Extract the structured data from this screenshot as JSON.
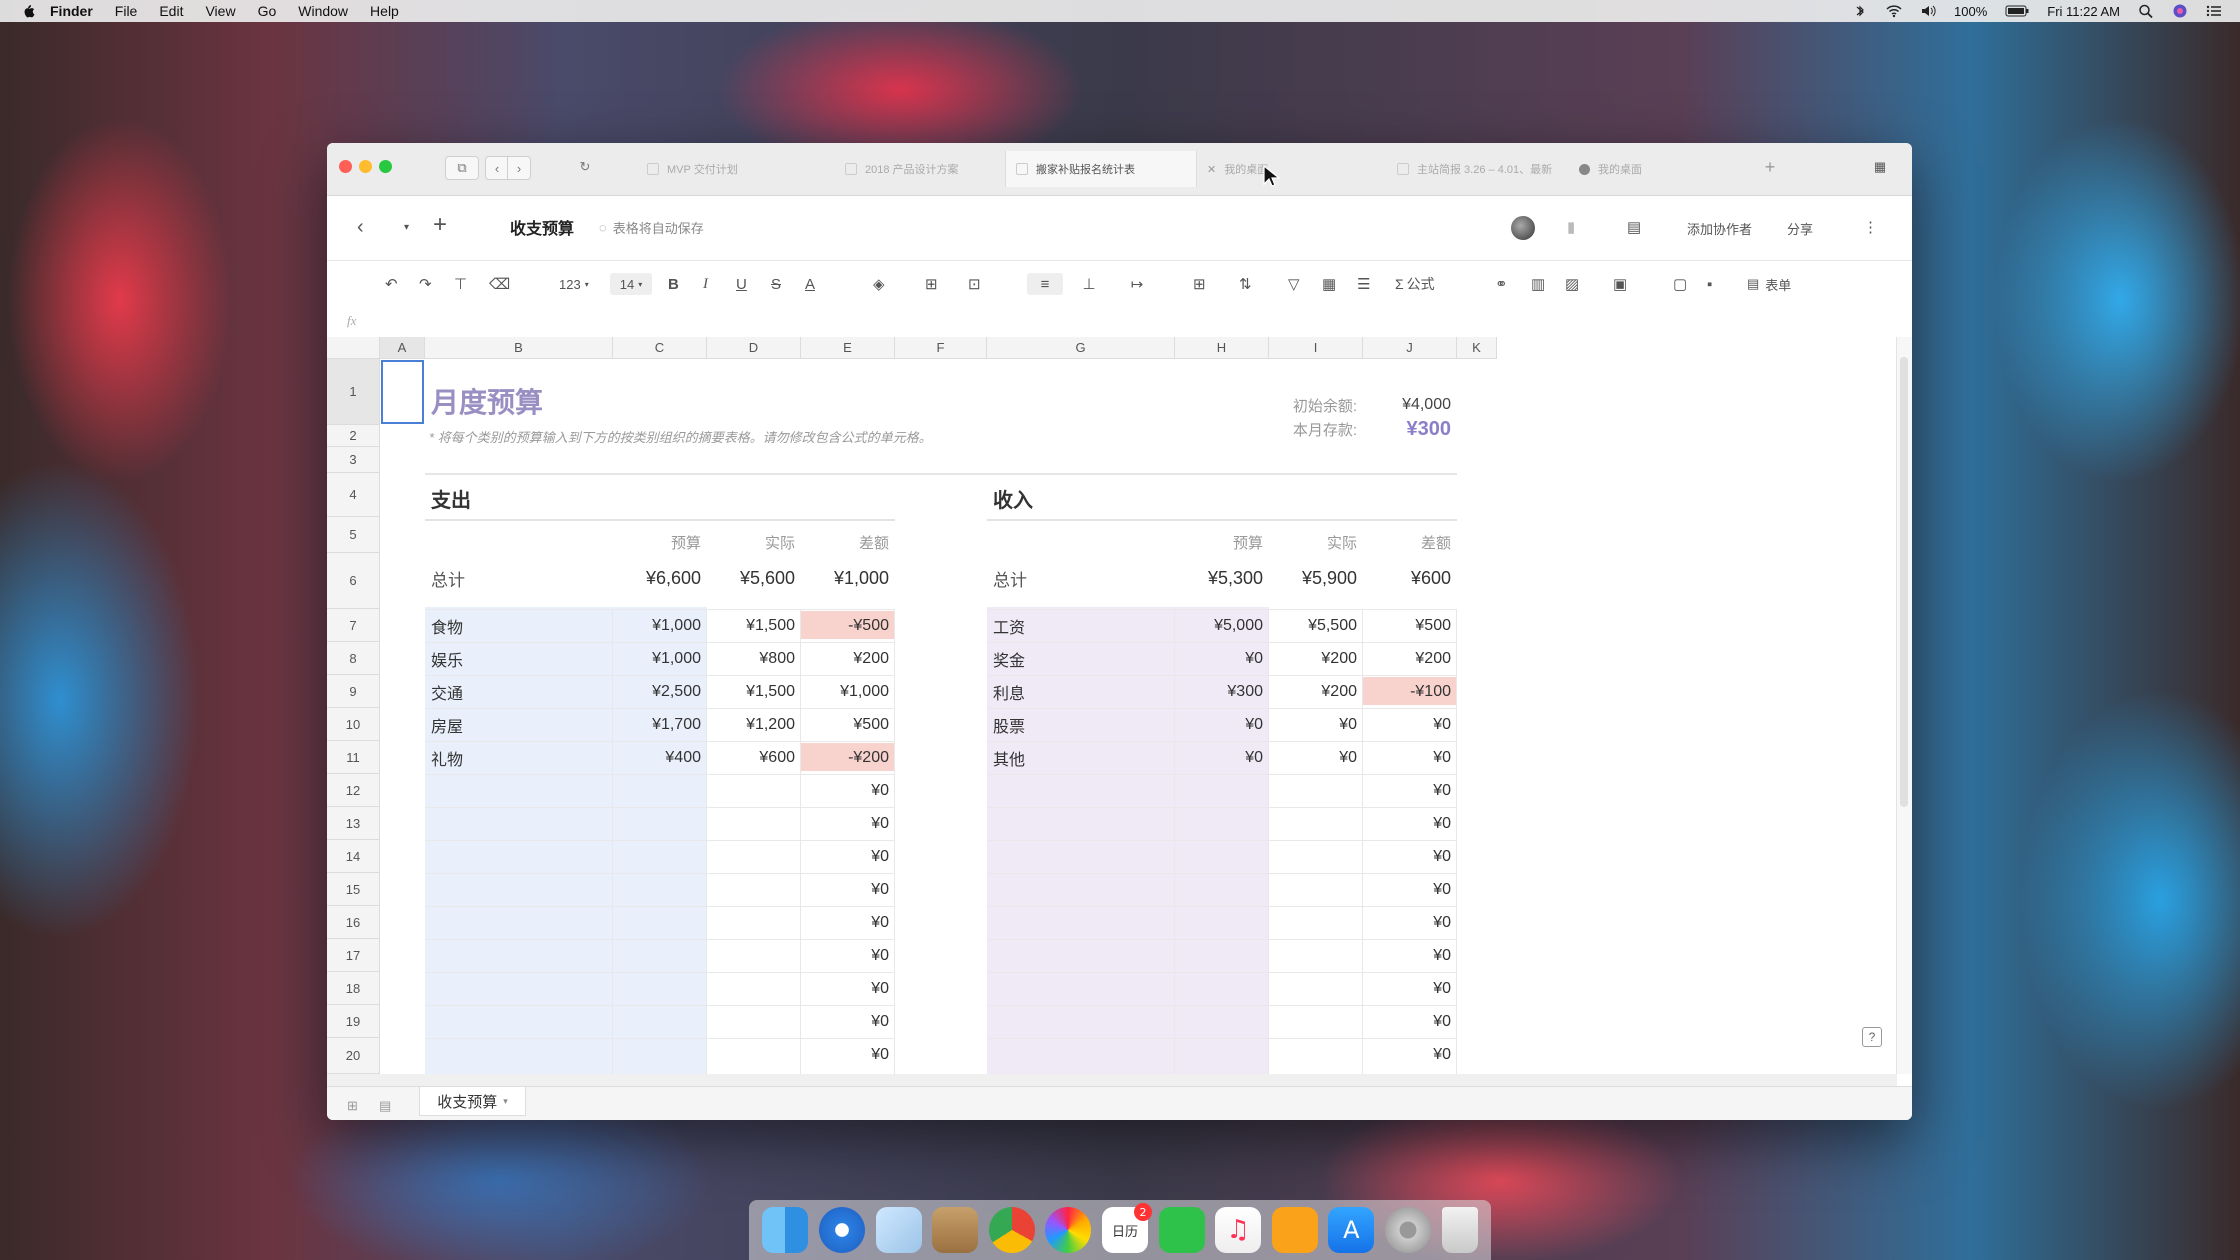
{
  "menubar": {
    "app": "Finder",
    "items": [
      "File",
      "Edit",
      "View",
      "Go",
      "Window",
      "Help"
    ],
    "battery": "100%",
    "clock": "Fri 11:22 AM"
  },
  "tabs": [
    {
      "label": "MVP 交付计划"
    },
    {
      "label": "2018 产品设计方案"
    },
    {
      "label": "搬家补贴报名统计表"
    },
    {
      "label": "我的桌面"
    },
    {
      "label": "主站简报 3.26 – 4.01、最新"
    },
    {
      "label": "我的桌面"
    }
  ],
  "header": {
    "title": "收支预算",
    "autosave": "表格将自动保存",
    "collab_btn": "添加协作者",
    "share_btn": "分享"
  },
  "toolbar": {
    "number_format": "123",
    "font_size": "14",
    "formula_label": "公式",
    "form_label": "表单"
  },
  "fx_label": "fx",
  "columns": [
    "A",
    "B",
    "C",
    "D",
    "E",
    "F",
    "G",
    "H",
    "I",
    "J",
    "K"
  ],
  "rows": [
    "1",
    "2",
    "3",
    "4",
    "5",
    "6",
    "7",
    "8",
    "9",
    "10",
    "11",
    "12",
    "13",
    "14",
    "15",
    "16",
    "17",
    "18",
    "19",
    "20"
  ],
  "sheet": {
    "title": "月度预算",
    "subtitle": "* 将每个类别的预算输入到下方的按类别组织的摘要表格。请勿修改包含公式的单元格。",
    "opening_balance_label": "初始余额:",
    "opening_balance": "¥4,000",
    "monthly_savings_label": "本月存款:",
    "monthly_savings": "¥300",
    "expense": {
      "heading": "支出",
      "col_budget": "预算",
      "col_actual": "实际",
      "col_diff": "差额",
      "total_label": "总计",
      "total_budget": "¥6,600",
      "total_actual": "¥5,600",
      "total_diff": "¥1,000",
      "rows": [
        {
          "cat": "食物",
          "budget": "¥1,000",
          "actual": "¥1,500",
          "diff": "-¥500"
        },
        {
          "cat": "娱乐",
          "budget": "¥1,000",
          "actual": "¥800",
          "diff": "¥200"
        },
        {
          "cat": "交通",
          "budget": "¥2,500",
          "actual": "¥1,500",
          "diff": "¥1,000"
        },
        {
          "cat": "房屋",
          "budget": "¥1,700",
          "actual": "¥1,200",
          "diff": "¥500"
        },
        {
          "cat": "礼物",
          "budget": "¥400",
          "actual": "¥600",
          "diff": "-¥200"
        }
      ],
      "empty_diff": "¥0"
    },
    "income": {
      "heading": "收入",
      "col_budget": "预算",
      "col_actual": "实际",
      "col_diff": "差额",
      "total_label": "总计",
      "total_budget": "¥5,300",
      "total_actual": "¥5,900",
      "total_diff": "¥600",
      "rows": [
        {
          "cat": "工资",
          "budget": "¥5,000",
          "actual": "¥5,500",
          "diff": "¥500"
        },
        {
          "cat": "奖金",
          "budget": "¥0",
          "actual": "¥200",
          "diff": "¥200"
        },
        {
          "cat": "利息",
          "budget": "¥300",
          "actual": "¥200",
          "diff": "-¥100"
        },
        {
          "cat": "股票",
          "budget": "¥0",
          "actual": "¥0",
          "diff": "¥0"
        },
        {
          "cat": "其他",
          "budget": "¥0",
          "actual": "¥0",
          "diff": "¥0"
        }
      ],
      "empty_diff": "¥0"
    }
  },
  "sheet_tab": "收支预算",
  "dock": {
    "calendar_badge": "2",
    "calendar_text": "日历"
  },
  "colors": {
    "expense_band": "#e9f0fb",
    "income_band": "#efeaf6",
    "negative_fill": "#f8d2cc",
    "title_purple": "#9a8fc2",
    "savings_purple": "#8a7fc8"
  }
}
